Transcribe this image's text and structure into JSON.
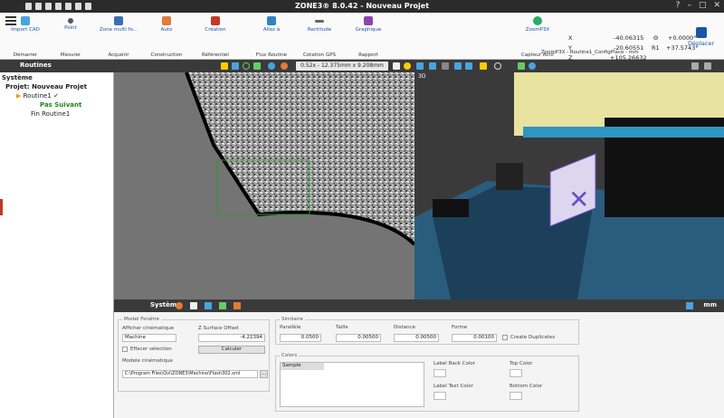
{
  "app": {
    "title": "ZONE3® 8.0.42 - Nouveau Projet"
  },
  "ribbon": {
    "groups": [
      {
        "label": "Import CAD",
        "group": "Démarrer",
        "color": "#4aa3df"
      },
      {
        "label": "Point",
        "group": "Mesurer",
        "color": "#555555"
      },
      {
        "label": "Zone multi fo...",
        "group": "Acquérir",
        "color": "#3b6fb6"
      },
      {
        "label": "Auto",
        "group": "Construction",
        "color": "#e07b39"
      },
      {
        "label": "Création",
        "group": "Référentiel",
        "color": "#c0392b"
      },
      {
        "label": "Allez à",
        "group": "Flux Routine",
        "color": "#2e86c1"
      },
      {
        "label": "Rectitude",
        "group": "Cotation GPS",
        "color": "#666666"
      },
      {
        "label": "Graphique",
        "group": "Rapport",
        "color": "#8e44ad"
      },
      {
        "label": "ZoomP3X",
        "group": "Capteur Actif",
        "color": "#27ae60"
      }
    ],
    "zoom_status": "ZoomP3X - Routine1_ConfigPlace - mm",
    "deplacer_label": "Déplacer"
  },
  "coordinates": {
    "x_label": "X",
    "x_value": "-40.06315",
    "y_label": "Y",
    "y_value": "-20.60551",
    "z_label": "Z",
    "z_value": "+105.26632",
    "theta_label": "Θ",
    "theta_value": "+0.0000°",
    "r1_label": "R1",
    "r1_value": "+37.5743°"
  },
  "toolbar": {
    "panel_title": "Routines",
    "zoom_text": "0.52x - 12.375mm x 9.208mm"
  },
  "tree": {
    "system": "Système",
    "project": "Projet: Nouveau Projet",
    "routine": "Routine1",
    "step": "Pas Suivant",
    "end": "Fin Routine1"
  },
  "view3d_label": "3D",
  "status": {
    "title": "Système",
    "unit": "mm"
  },
  "props": {
    "model_legend": "Model Fenêtre",
    "afficher_label": "Afficher cinématique",
    "afficher_value": "Machine",
    "zsurface_label": "Z Surface Offset",
    "zsurface_value": "-4.22394",
    "effacer_label": "Effacer sélection",
    "calculer_label": "Calculer",
    "model_cine_label": "Modele cinématique",
    "model_path": "C:\\Program Files\\Qvi\\ZONE3\\Machine\\Flash302.xml",
    "browse_label": "...",
    "similaire_legend": "Similaire",
    "parallele_label": "Parallèle",
    "parallele_value": "0.0500",
    "taille_label": "Taille",
    "taille_value": "0.00500",
    "distance_label": "Distance",
    "distance_value": "0.00500",
    "forme_label": "Forme",
    "forme_value": "0.00100",
    "create_dup_label": "Create Duplicates",
    "colors_legend": "Colors",
    "sample_label": "Sample",
    "label_back_color": "Label Back Color",
    "top_color": "Top Color",
    "label_text_color": "Label Text Color",
    "bottom_color": "Bottom Color"
  }
}
